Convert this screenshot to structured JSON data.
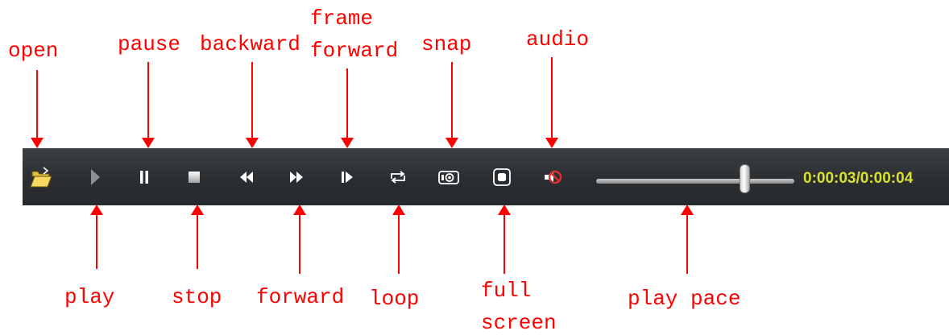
{
  "labels": {
    "open": "open",
    "pause": "pause",
    "backward": "backward",
    "frame_forward_line1": "frame",
    "frame_forward_line2": "forward",
    "snap": "snap",
    "audio": "audio",
    "play": "play",
    "stop": "stop",
    "forward": "forward",
    "loop": "loop",
    "full_screen_line1": "full",
    "full_screen_line2": "screen",
    "play_pace": "play pace"
  },
  "toolbar": {
    "time_display": "0:00:03/0:00:04",
    "progress_fraction": 0.75,
    "buttons": [
      {
        "id": "open",
        "icon": "folder-open-icon"
      },
      {
        "id": "play",
        "icon": "play-icon"
      },
      {
        "id": "pause",
        "icon": "pause-icon"
      },
      {
        "id": "stop",
        "icon": "stop-icon"
      },
      {
        "id": "backward",
        "icon": "rewind-icon"
      },
      {
        "id": "forward",
        "icon": "fast-forward-icon"
      },
      {
        "id": "frame_forward",
        "icon": "frame-step-icon"
      },
      {
        "id": "loop",
        "icon": "loop-icon"
      },
      {
        "id": "snap",
        "icon": "camera-icon"
      },
      {
        "id": "full_screen",
        "icon": "fullscreen-icon"
      },
      {
        "id": "audio",
        "icon": "mute-speaker-icon"
      }
    ]
  },
  "colors": {
    "annotation": "#ff0000",
    "toolbar_bg": "#2b2f32",
    "time_text": "#d8e030",
    "icon": "#ffffff"
  }
}
